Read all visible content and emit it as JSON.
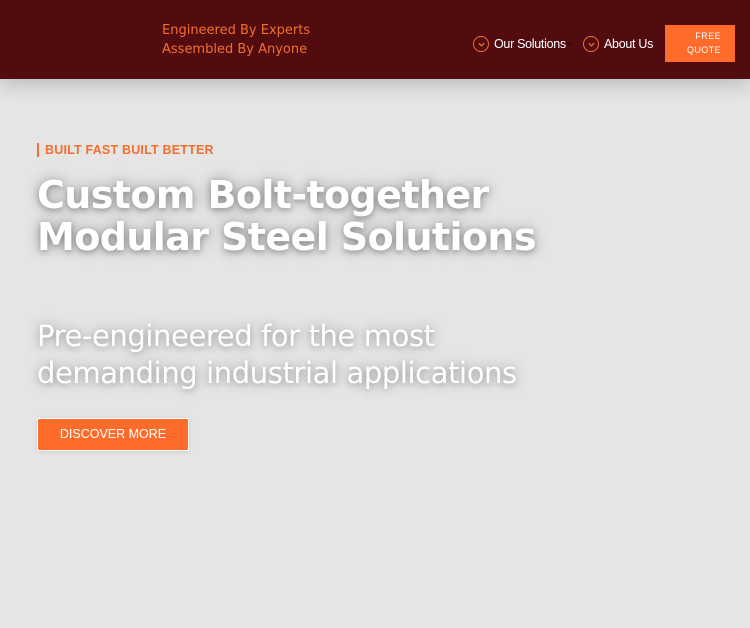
{
  "header": {
    "tagline": [
      "Engineered By Experts",
      "Assembled By Anyone"
    ],
    "nav": [
      {
        "label": "Our Solutions",
        "icon": "chevron-down-circle-icon"
      },
      {
        "label": "About Us",
        "icon": "chevron-down-circle-icon"
      }
    ],
    "quote_button": [
      "FREE",
      "QUOTE"
    ]
  },
  "hero": {
    "eyebrow": "BUILT FAST BUILT BETTER",
    "title": [
      "Custom Bolt-together",
      "Modular Steel Solutions"
    ],
    "subtitle": [
      "Pre-engineered for the most",
      "demanding industrial applications"
    ],
    "cta_label": "DISCOVER MORE"
  },
  "colors": {
    "header_bg": "#520b0f",
    "accent": "#ff6b2b",
    "page_bg": "#e5e5e5"
  }
}
